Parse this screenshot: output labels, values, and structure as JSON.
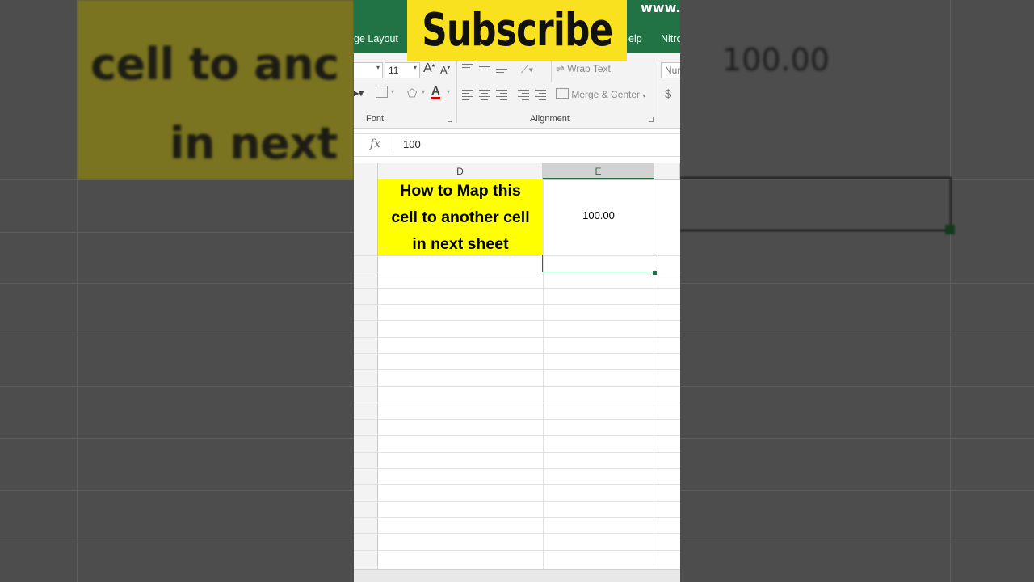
{
  "overlay": {
    "subscribe_label": "Subscribe",
    "url_fragment": "www.",
    "accent_color": "#f9e120"
  },
  "ribbon_tabs": {
    "page_layout": "ge Layout",
    "help": "elp",
    "nitro": "Nitro"
  },
  "ribbon": {
    "font_size": "11",
    "grow_font": "A",
    "shrink_font": "A",
    "font_color_letter": "A",
    "wrap_text": "Wrap Text",
    "merge_center": "Merge & Center",
    "number_format": "Nur",
    "currency": "$",
    "font_group": "Font",
    "alignment_group": "Alignment",
    "brand_color": "#217346"
  },
  "formula_bar": {
    "fx": "fx",
    "value": "100"
  },
  "columns": [
    "D",
    "E"
  ],
  "cells": {
    "d1": "How to Map this\ncell to another cell\nin next sheet",
    "e1": "100.00"
  },
  "background": {
    "blur_line_1": "cell to anc",
    "blur_line_2": "in next",
    "blur_value": "100.00"
  }
}
